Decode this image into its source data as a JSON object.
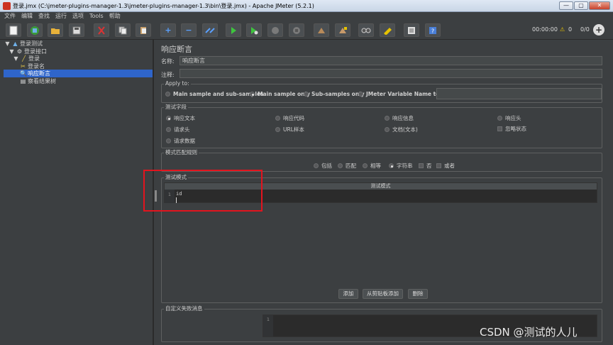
{
  "window": {
    "title": "登录.jmx (C:\\jmeter-plugins-manager-1.3\\jmeter-plugins-manager-1.3\\bin\\登录.jmx) - Apache JMeter (5.2.1)",
    "minimize": "—",
    "maximize": "▢",
    "close": "✕"
  },
  "menu": [
    "文件",
    "编辑",
    "查找",
    "运行",
    "选项",
    "Tools",
    "帮助"
  ],
  "toolbar": {
    "timer": "00:00:00",
    "warnings": "0",
    "threads": "0/0"
  },
  "tree": {
    "items": [
      {
        "label": "登录测试",
        "level": 0,
        "icon": "testplan-icon"
      },
      {
        "label": "登录接口",
        "level": 1,
        "icon": "threadgroup-icon"
      },
      {
        "label": "登录",
        "level": 2,
        "icon": "sampler-icon"
      },
      {
        "label": "登录名",
        "level": 3,
        "icon": "extractor-icon"
      },
      {
        "label": "响应断言",
        "level": 3,
        "icon": "assertion-icon",
        "selected": true
      },
      {
        "label": "察看结果树",
        "level": 2,
        "icon": "listener-icon"
      }
    ]
  },
  "panel": {
    "title": "响应断言",
    "name_label": "名称:",
    "name_value": "响应断言",
    "comment_label": "注释:",
    "comment_value": "",
    "apply_to": {
      "legend": "Apply to:",
      "options": [
        "Main sample and sub-samples",
        "Main sample only",
        "Sub-samples only",
        "JMeter Variable Name to use"
      ],
      "selected": "Main sample only",
      "variable_value": ""
    },
    "field_to_test": {
      "legend": "测试字段",
      "options": [
        "响应文本",
        "响应代码",
        "响应信息",
        "响应头",
        "请求头",
        "URL样本",
        "文档(文本)",
        "请求数据"
      ],
      "selected": "响应文本",
      "ignore_status_label": "忽略状态",
      "ignore_status_checked": false
    },
    "matching_rules": {
      "legend": "模式匹配规则",
      "options": [
        "包括",
        "匹配",
        "相等",
        "字符串"
      ],
      "selected": "字符串",
      "not_label": "否",
      "or_label": "或者"
    },
    "patterns": {
      "legend": "测试模式",
      "column_header": "测试模式",
      "line_number": "1",
      "content": "id"
    },
    "buttons": {
      "add": "添加",
      "add_clipboard": "从剪贴板添加",
      "delete": "删除"
    },
    "custom_failure": {
      "legend": "自定义失败消息",
      "line_number": "1",
      "content": ""
    }
  },
  "watermark": "CSDN @测试的人儿",
  "colors": {
    "selection": "#2f65ca",
    "highlight_box": "#e2141e",
    "background": "#3c3f41"
  }
}
